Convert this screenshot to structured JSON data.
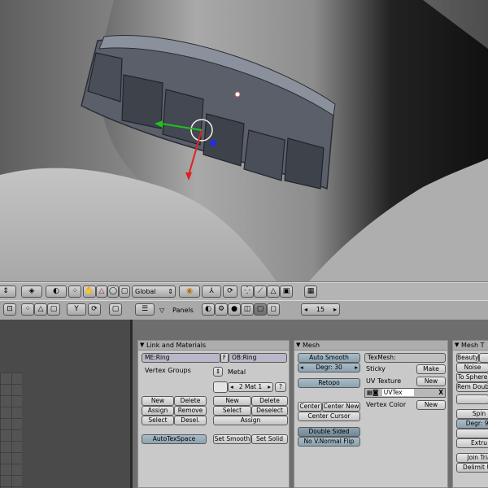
{
  "viewport": {
    "name": "3d-viewport"
  },
  "header1": {
    "transform_orientation": "Global"
  },
  "header2": {
    "panels_label": "Panels",
    "frame_number": "15"
  },
  "panels": {
    "link_materials": {
      "title": "Link and Materials",
      "me_field": "ME:Ring",
      "f_label": "F",
      "ob_field": "OB:Ring",
      "vertex_groups": "Vertex Groups",
      "metal": "Metal",
      "mat_field": "2 Mat 1",
      "question": "?",
      "new": "New",
      "delete": "Delete",
      "assign": "Assign",
      "remove": "Remove",
      "select": "Select",
      "desel": "Desel.",
      "new2": "New",
      "delete2": "Delete",
      "select2": "Select",
      "deselect2": "Deselect",
      "assign2": "Assign",
      "autotexspace": "AutoTexSpace",
      "set_smooth": "Set Smooth",
      "set_solid": "Set Solid"
    },
    "mesh": {
      "title": "Mesh",
      "auto_smooth": "Auto Smooth",
      "degr": "Degr: 30",
      "retopo": "Retopo",
      "center": "Center",
      "center_new": "Center New",
      "center_cursor": "Center Cursor",
      "double_sided": "Double Sided",
      "no_vnormal_flip": "No V.Normal Flip",
      "texmesh": "TexMesh:",
      "sticky": "Sticky",
      "make": "Make",
      "uv_texture": "UV Texture",
      "new_uv": "New",
      "uvtex": "UVTex",
      "x_label": "X",
      "vertex_color": "Vertex Color",
      "new_vc": "New"
    },
    "mesh_tools": {
      "title": "Mesh T",
      "beauty": "Beauty",
      "s_cut": "S",
      "noise": "Noise",
      "to_sphere": "To Sphere",
      "rem_doubles": "Rem Doub",
      "spin": "Spin",
      "degr90": "Degr: 90",
      "extrude": "Extru",
      "join_tri": "Join Tria",
      "delimit": "Delimit UV"
    }
  },
  "colors": {
    "viewport_bg": "#7a7a7a",
    "button_blue": "#9bb0bd",
    "panel_bg": "#c9c9c9",
    "header_bg": "#b4b4b4"
  }
}
